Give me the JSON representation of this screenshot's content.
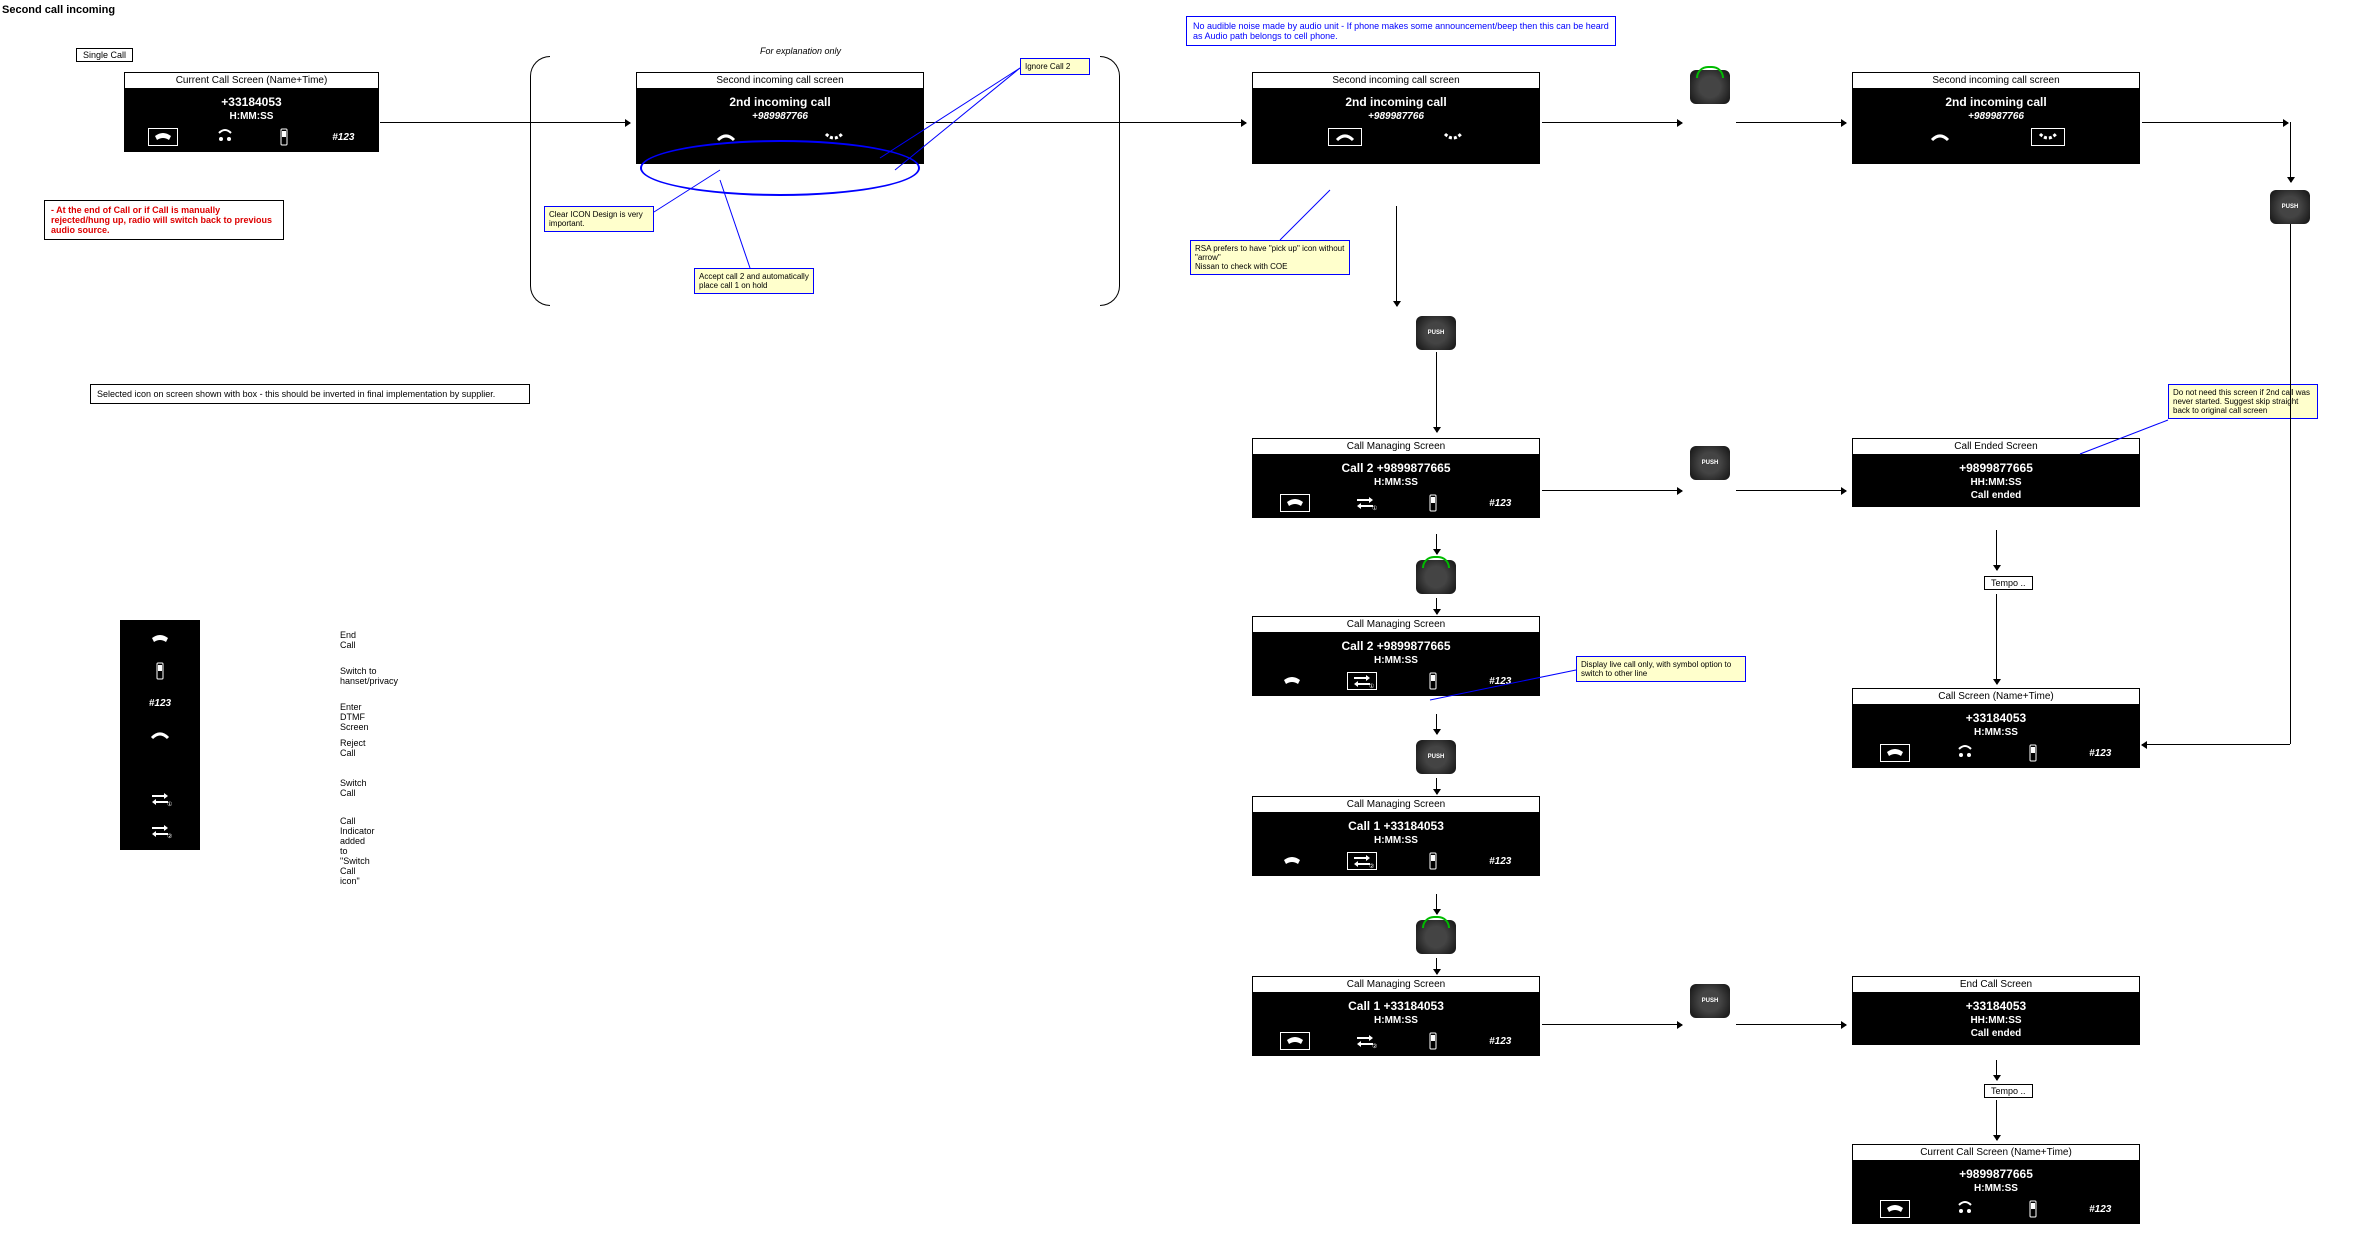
{
  "title": "Second call incoming",
  "tag_single_call": "Single Call",
  "explain_label": "For explanation only",
  "screens": {
    "s1": {
      "hdr": "Current Call Screen (Name+Time)",
      "l1": "+33184053",
      "l2": "H:MM:SS"
    },
    "s2": {
      "hdr": "Second incoming call screen",
      "l1": "2nd incoming call",
      "l2": "+989987766"
    },
    "s3": {
      "hdr": "Second incoming call screen",
      "l1": "2nd incoming call",
      "l2": "+989987766"
    },
    "s4": {
      "hdr": "Second incoming call screen",
      "l1": "2nd incoming call",
      "l2": "+989987766"
    },
    "s5": {
      "hdr": "Call Managing Screen",
      "l1": "Call 2 +9899877665",
      "l2": "H:MM:SS"
    },
    "s6": {
      "hdr": "Call Ended Screen",
      "l1": "+9899877665",
      "l2": "HH:MM:SS",
      "l3": "Call ended"
    },
    "s7": {
      "hdr": "Call Managing Screen",
      "l1": "Call 2 +9899877665",
      "l2": "H:MM:SS"
    },
    "s8": {
      "hdr": "Call Screen (Name+Time)",
      "l1": "+33184053",
      "l2": "H:MM:SS"
    },
    "s9": {
      "hdr": "Call Managing Screen",
      "l1": "Call 1 +33184053",
      "l2": "H:MM:SS"
    },
    "s10": {
      "hdr": "Call Managing Screen",
      "l1": "Call 1 +33184053",
      "l2": "H:MM:SS"
    },
    "s11": {
      "hdr": "End Call Screen",
      "l1": "+33184053",
      "l2": "HH:MM:SS",
      "l3": "Call ended"
    },
    "s12": {
      "hdr": "Current Call Screen (Name+Time)",
      "l1": "+9899877665",
      "l2": "H:MM:SS"
    }
  },
  "dtmf": "#123",
  "notes": {
    "red1": "- At the end of Call or if Call is manually rejected/hung up, radio will switch back to previous audio source.",
    "sel_note": "Selected icon on screen shown with box - this should be inverted in final implementation by supplier.",
    "blue_top": "No audible noise made by audio unit - If phone makes some announcement/beep then this can be heard as Audio path belongs to cell phone.",
    "ignore": "Ignore Call 2",
    "clear_icon": "Clear ICON Design is very important.",
    "accept": "Accept call 2 and automatically place call 1 on hold",
    "rsa": "RSA prefers to have \"pick up\" icon without \"arrow\"\nNissan to check with COE",
    "display_live": "Display live call only, with symbol option to switch to other line",
    "skip": "Do not need this screen if 2nd call was never started. Suggest skip straight back to original call screen",
    "tempo": "Tempo .."
  },
  "legend": {
    "end_call": "End Call",
    "privacy": "Switch to hanset/privacy",
    "dtmf": "Enter DTMF Screen",
    "reject": "Reject Call",
    "switch": "Switch Call",
    "indicator": "Call Indicator\nadded to \"Switch Call icon\""
  },
  "push_label": "PUSH"
}
